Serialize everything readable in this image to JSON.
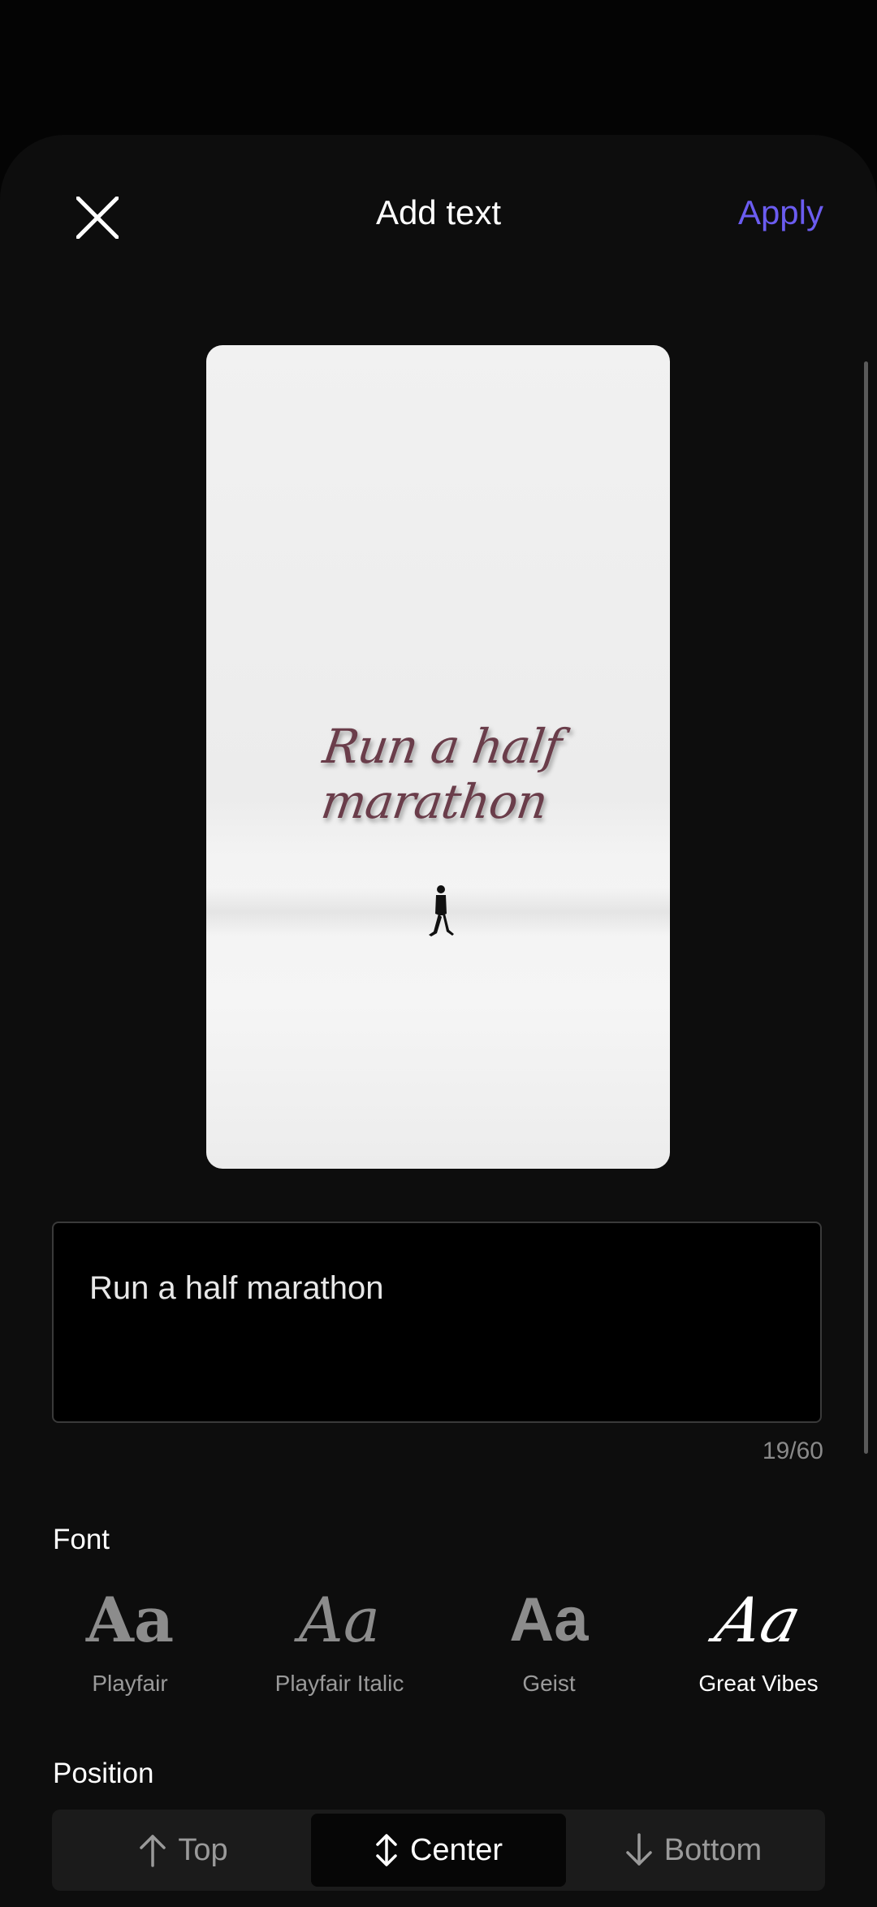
{
  "header": {
    "title": "Add text",
    "apply_label": "Apply",
    "close_icon": "close-icon"
  },
  "preview": {
    "overlay_text": "Run a half marathon",
    "overlay_color": "#6a3d4a"
  },
  "editor": {
    "value": "Run a half marathon",
    "counter": "19/60"
  },
  "font": {
    "label": "Font",
    "options": [
      {
        "sample": "Aa",
        "name": "Playfair"
      },
      {
        "sample": "Aa",
        "name": "Playfair Italic"
      },
      {
        "sample": "Aa",
        "name": "Geist"
      },
      {
        "sample": "Aa",
        "name": "Great Vibes"
      }
    ],
    "selected": "Great Vibes"
  },
  "position": {
    "label": "Position",
    "options": [
      {
        "label": "Top",
        "icon": "arrow-up-icon"
      },
      {
        "label": "Center",
        "icon": "arrow-up-down-icon"
      },
      {
        "label": "Bottom",
        "icon": "arrow-down-icon"
      }
    ],
    "selected": "Center"
  },
  "colors": {
    "accent": "#6b5cf0",
    "background": "#0d0d0d"
  }
}
